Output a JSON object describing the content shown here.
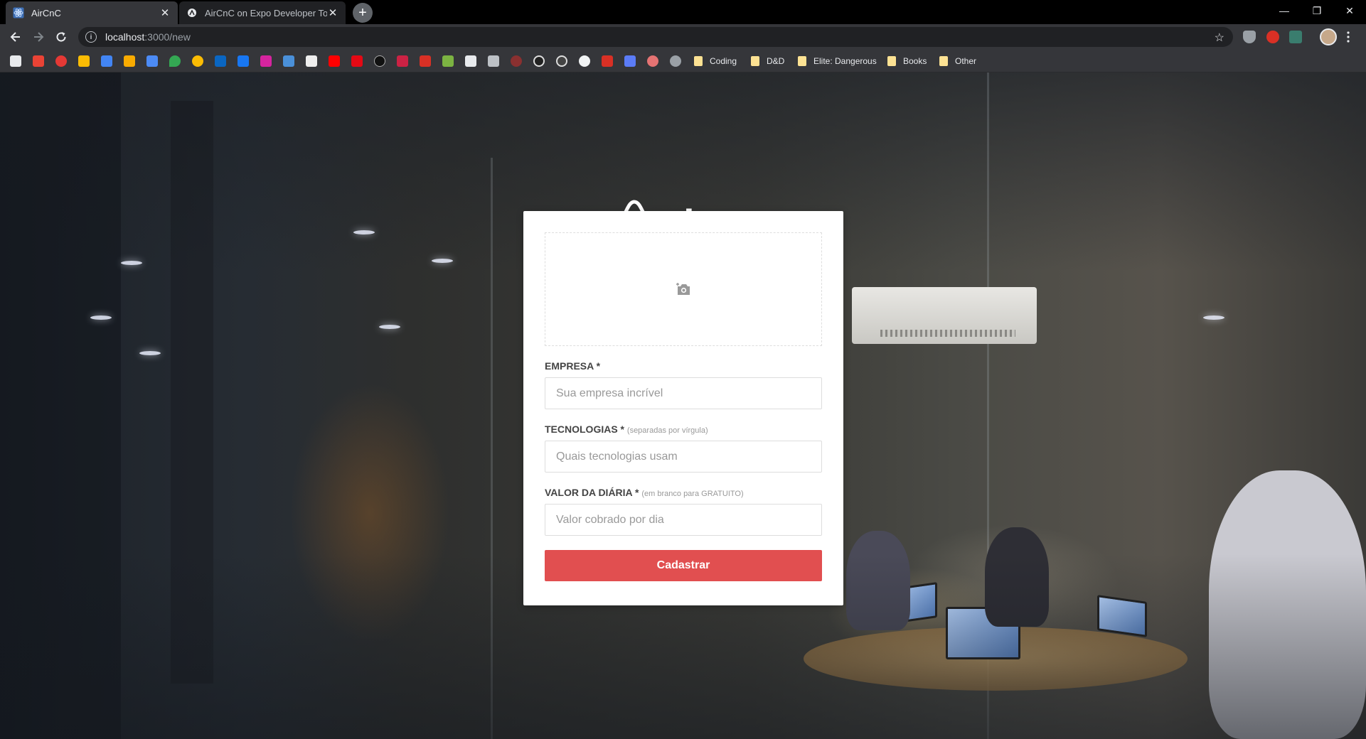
{
  "browser": {
    "tabs": [
      {
        "title": "AirCnC",
        "active": true
      },
      {
        "title": "AirCnC on Expo Developer Tools",
        "active": false
      }
    ],
    "address": {
      "host": "localhost",
      "path": ":3000/new"
    },
    "bookmark_folders": [
      "Coding",
      "D&D",
      "Elite: Dangerous",
      "Books",
      "Other"
    ]
  },
  "brand": {
    "name": "aircnc"
  },
  "form": {
    "upload_icon": "camera-icon",
    "company": {
      "label": "EMPRESA *",
      "placeholder": "Sua empresa incrível"
    },
    "techs": {
      "label": "TECNOLOGIAS *",
      "hint": "(separadas por vírgula)",
      "placeholder": "Quais tecnologias usam"
    },
    "price": {
      "label": "VALOR DA DIÁRIA *",
      "hint": "(em branco para GRATUITO)",
      "placeholder": "Valor cobrado por dia"
    },
    "submit_label": "Cadastrar"
  },
  "colors": {
    "accent": "#e14f50",
    "tab_active": "#35363a",
    "chrome": "#000000"
  }
}
